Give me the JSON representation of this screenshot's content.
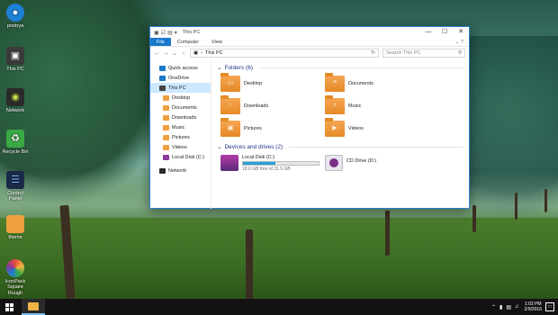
{
  "desktop": {
    "icons": [
      {
        "label": "pootrya",
        "icon": "user-icon",
        "color": "#1d7fd6"
      },
      {
        "label": "This PC",
        "icon": "computer-icon",
        "color": "#3a3a3a"
      },
      {
        "label": "Network",
        "icon": "network-icon",
        "color": "#2b2b2b"
      },
      {
        "label": "Recycle Bin",
        "icon": "recycle-bin-icon",
        "color": "#3aa845"
      },
      {
        "label": "Control Panel",
        "icon": "control-panel-icon",
        "color": "#1c2a4a"
      },
      {
        "label": "theme",
        "icon": "folder-icon",
        "color": "#f0a040"
      },
      {
        "label": "IconPack Square Rough",
        "icon": "iconpack-icon",
        "color": "#222"
      }
    ]
  },
  "window": {
    "title": "This PC",
    "ribbon_tabs": [
      "File",
      "Computer",
      "View"
    ],
    "controls": {
      "minimize": "—",
      "maximize": "☐",
      "close": "✕"
    },
    "address": {
      "path": "This PC"
    },
    "search": {
      "placeholder": "Search This PC"
    },
    "nav_pane": [
      {
        "label": "Quick access",
        "icon": "star-icon",
        "color": "#1979ca",
        "level": 0
      },
      {
        "label": "OneDrive",
        "icon": "cloud-icon",
        "color": "#1979ca",
        "level": 0
      },
      {
        "label": "This PC",
        "icon": "computer-icon",
        "color": "#444",
        "level": 0,
        "selected": true
      },
      {
        "label": "Desktop",
        "icon": "folder-icon",
        "color": "#f0a040",
        "level": 1
      },
      {
        "label": "Documents",
        "icon": "folder-icon",
        "color": "#f0a040",
        "level": 1
      },
      {
        "label": "Downloads",
        "icon": "folder-icon",
        "color": "#f0a040",
        "level": 1
      },
      {
        "label": "Music",
        "icon": "folder-icon",
        "color": "#f0a040",
        "level": 1
      },
      {
        "label": "Pictures",
        "icon": "folder-icon",
        "color": "#f0a040",
        "level": 1
      },
      {
        "label": "Videos",
        "icon": "folder-icon",
        "color": "#f0a040",
        "level": 1
      },
      {
        "label": "Local Disk (C:)",
        "icon": "drive-icon",
        "color": "#8a3a9a",
        "level": 1
      },
      {
        "label": "Network",
        "icon": "network-icon",
        "color": "#2b2b2b",
        "level": 0
      }
    ],
    "folders_header": "Folders (6)",
    "folders": [
      {
        "label": "Desktop",
        "glyph": "▭"
      },
      {
        "label": "Documents",
        "glyph": "≡"
      },
      {
        "label": "Downloads",
        "glyph": "↓"
      },
      {
        "label": "Music",
        "glyph": "♪"
      },
      {
        "label": "Pictures",
        "glyph": "▣"
      },
      {
        "label": "Videos",
        "glyph": "▶"
      }
    ],
    "drives_header": "Devices and drives (2)",
    "drives": [
      {
        "label": "Local Disk (C:)",
        "free_text": "18.0 GB free of 31.5 GB",
        "used_fraction": 0.43
      },
      {
        "label": "CD Drive (D:)"
      }
    ]
  },
  "taskbar": {
    "time": "1:03 PM",
    "date": "2/9/2016"
  }
}
